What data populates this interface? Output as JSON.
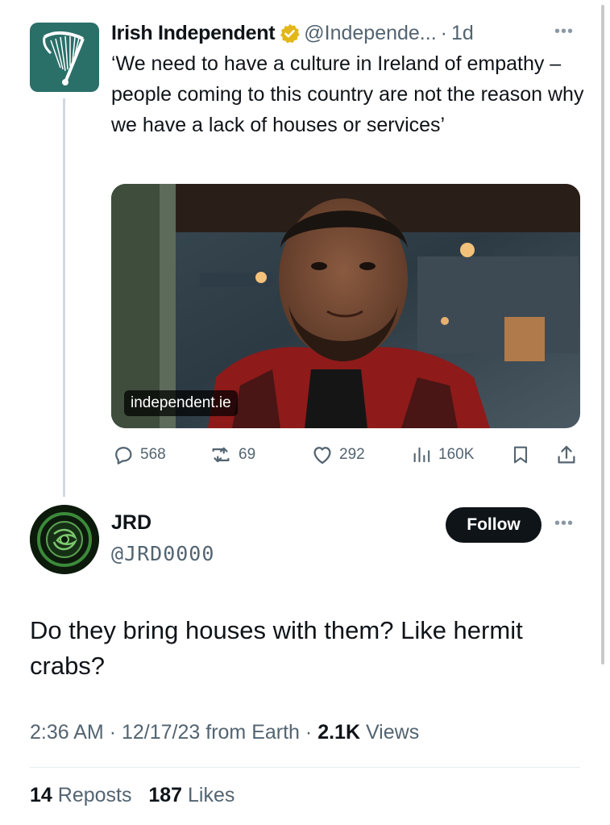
{
  "quoted_tweet": {
    "display_name": "Irish Independent",
    "handle": "@Independe...",
    "separator": "·",
    "time_ago": "1d",
    "more_icon": "ellipsis-icon",
    "text": "‘We need to have a culture in Ireland of empathy – people coming to this country are not the reason why we have a lack of houses or services’",
    "link_card": {
      "domain": "independent.ie"
    },
    "actions": {
      "replies": "568",
      "reposts": "69",
      "likes": "292",
      "views": "160K"
    }
  },
  "tweet": {
    "display_name": "JRD",
    "handle": "@JRD0000",
    "follow_label": "Follow",
    "text": "Do they bring houses with them? Like hermit crabs?",
    "meta": {
      "time": "2:36 AM",
      "date": "12/17/23",
      "source": "from Earth",
      "views_count": "2.1K",
      "views_label": "Views"
    },
    "stats": {
      "reposts_count": "14",
      "reposts_label": "Reposts",
      "likes_count": "187",
      "likes_label": "Likes"
    }
  },
  "colors": {
    "brand_teal": "#2b6f69",
    "verified_gold": "#e2b719",
    "secondary_text": "#536471",
    "follow_bg": "#0f1419"
  }
}
